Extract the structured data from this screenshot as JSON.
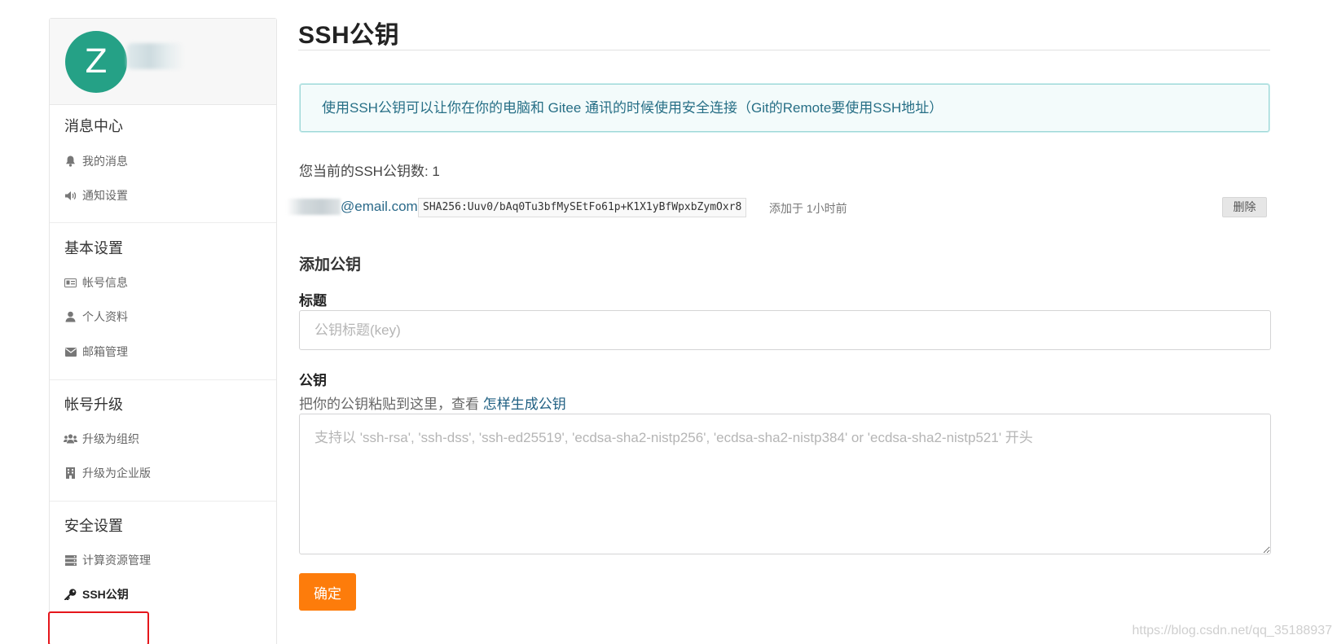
{
  "sidebar": {
    "avatar_letter": "Z",
    "sections": [
      {
        "title": "消息中心",
        "items": [
          {
            "label": "我的消息",
            "icon": "bell-icon"
          },
          {
            "label": "通知设置",
            "icon": "volume-icon"
          }
        ]
      },
      {
        "title": "基本设置",
        "items": [
          {
            "label": "帐号信息",
            "icon": "id-card-icon"
          },
          {
            "label": "个人资料",
            "icon": "user-icon"
          },
          {
            "label": "邮箱管理",
            "icon": "envelope-icon"
          }
        ]
      },
      {
        "title": "帐号升级",
        "items": [
          {
            "label": "升级为组织",
            "icon": "users-icon"
          },
          {
            "label": "升级为企业版",
            "icon": "building-icon"
          }
        ]
      },
      {
        "title": "安全设置",
        "items": [
          {
            "label": "计算资源管理",
            "icon": "server-icon"
          },
          {
            "label": "SSH公钥",
            "icon": "key-icon",
            "active": true
          }
        ]
      }
    ]
  },
  "main": {
    "title": "SSH公钥",
    "info": "使用SSH公钥可以让你在你的电脑和 Gitee 通讯的时候使用安全连接（Git的Remote要使用SSH地址）",
    "key_count_label": "您当前的SSH公钥数: 1",
    "keys": [
      {
        "email_suffix": "@email.com",
        "fingerprint": "SHA256:Uuv0/bAq0Tu3bfMySEtFo61p+K1X1yBfWpxbZymOxr8",
        "added": "添加于 1小时前",
        "delete_label": "删除"
      }
    ],
    "add_heading": "添加公钥",
    "title_label": "标题",
    "title_placeholder": "公钥标题(key)",
    "key_label": "公钥",
    "help_text": "把你的公钥粘贴到这里，查看 ",
    "help_link": "怎样生成公钥",
    "key_placeholder": "支持以 'ssh-rsa', 'ssh-dss', 'ssh-ed25519', 'ecdsa-sha2-nistp256', 'ecdsa-sha2-nistp384' or 'ecdsa-sha2-nistp521' 开头",
    "submit_label": "确定"
  },
  "watermark": "https://blog.csdn.net/qq_35188937",
  "colors": {
    "accent": "#fd7c0b",
    "avatar": "#25a186",
    "info_text": "#276f86",
    "link": "#1f5f82",
    "active_outline": "#e5161b"
  }
}
